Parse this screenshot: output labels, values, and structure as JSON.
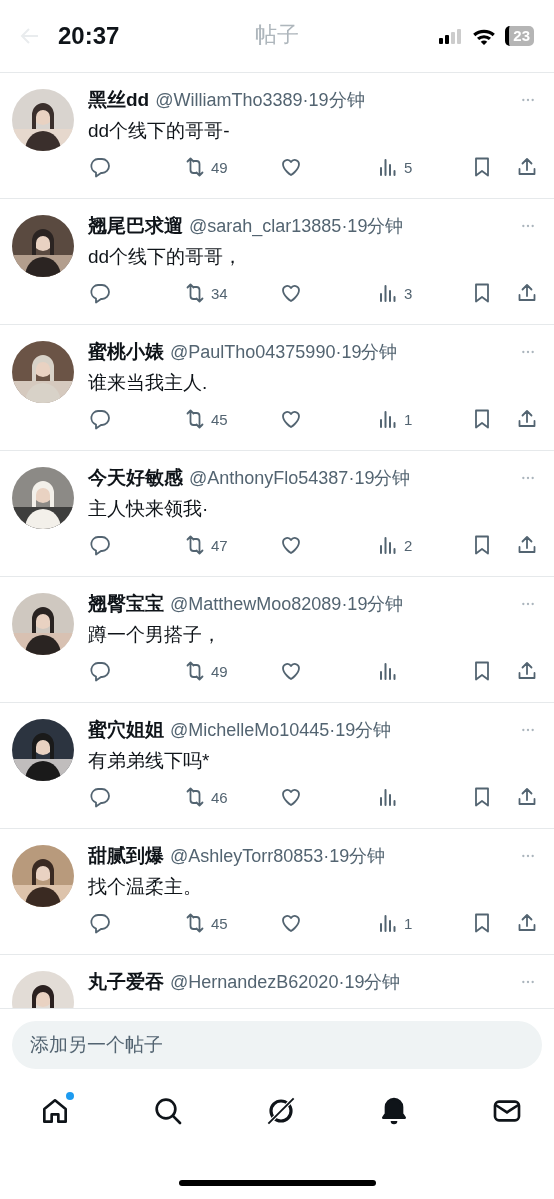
{
  "status_bar": {
    "time": "20:37",
    "battery": "23"
  },
  "header": {
    "title": "帖子"
  },
  "posts": [
    {
      "name": "黑丝dd",
      "handle": "@WilliamTho3389",
      "time": "·19分钟",
      "text": "dd个线下的哥哥-",
      "retweets": "49",
      "views": "5"
    },
    {
      "name": "翘尾巴求遛",
      "handle": "@sarah_clar13885",
      "time": "·19分钟",
      "text": "dd个线下的哥哥，",
      "retweets": "34",
      "views": "3"
    },
    {
      "name": "蜜桃小婊",
      "handle": "@PaulTho04375990",
      "time": "·19分钟",
      "text": "谁来当我主人.",
      "retweets": "45",
      "views": "1"
    },
    {
      "name": "今天好敏感",
      "handle": "@AnthonyFlo54387",
      "time": "·19分钟",
      "text": "主人快来领我·",
      "retweets": "47",
      "views": "2"
    },
    {
      "name": "翘臀宝宝",
      "handle": "@MatthewMoo82089",
      "time": "·19分钟",
      "text": "蹲一个男搭子，",
      "retweets": "49"
    },
    {
      "name": "蜜穴姐姐",
      "handle": "@MichelleMo10445",
      "time": "·19分钟",
      "text": "有弟弟线下吗*",
      "retweets": "46"
    },
    {
      "name": "甜腻到爆",
      "handle": "@AshleyTorr80853",
      "time": "·19分钟",
      "text": "找个温柔主。",
      "retweets": "45",
      "views": "1"
    },
    {
      "name": "丸子爱吞",
      "handle": "@HernandezB62020",
      "time": "·19分钟"
    }
  ],
  "composer": {
    "placeholder": "添加另一个帖子"
  },
  "nav": [
    {
      "kind": "home",
      "dot": true
    },
    {
      "kind": "search",
      "dot": false
    },
    {
      "kind": "grok",
      "dot": false
    },
    {
      "kind": "notifications",
      "dot": false
    },
    {
      "kind": "messages",
      "dot": false
    }
  ]
}
